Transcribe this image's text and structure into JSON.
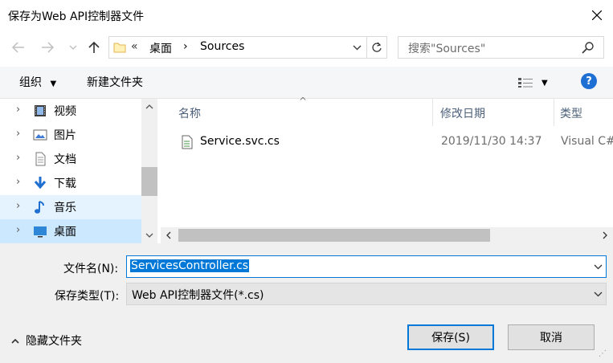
{
  "window": {
    "title": "保存为Web API控制器文件"
  },
  "address": {
    "breadcrumb_prefix": "«",
    "segments": [
      "桌面",
      "Sources"
    ],
    "separator": "›"
  },
  "search": {
    "placeholder": "搜索\"Sources\""
  },
  "toolbar": {
    "organize_label": "组织",
    "new_folder_label": "新建文件夹"
  },
  "nav": {
    "items": [
      {
        "label": "视频",
        "icon": "video-icon"
      },
      {
        "label": "图片",
        "icon": "picture-icon"
      },
      {
        "label": "文档",
        "icon": "document-icon"
      },
      {
        "label": "下载",
        "icon": "download-icon"
      },
      {
        "label": "音乐",
        "icon": "music-icon"
      },
      {
        "label": "桌面",
        "icon": "desktop-icon"
      }
    ]
  },
  "filelist": {
    "columns": [
      "名称",
      "修改日期",
      "类型"
    ],
    "rows": [
      {
        "name": "Service.svc.cs",
        "date": "2019/11/30 14:37",
        "type": "Visual C#"
      }
    ]
  },
  "bottom": {
    "filename_label": "文件名(N):",
    "filename_value": "ServicesController.cs",
    "type_label": "保存类型(T):",
    "type_value": "Web API控制器文件(*.cs)",
    "hide_folders_label": "隐藏文件夹",
    "save_label": "保存(S)",
    "cancel_label": "取消"
  },
  "colors": {
    "accent": "#0078d7",
    "selection": "#cce8ff",
    "toolbar_bg": "#f5f6f7",
    "footer_bg": "#f0f0f0"
  }
}
